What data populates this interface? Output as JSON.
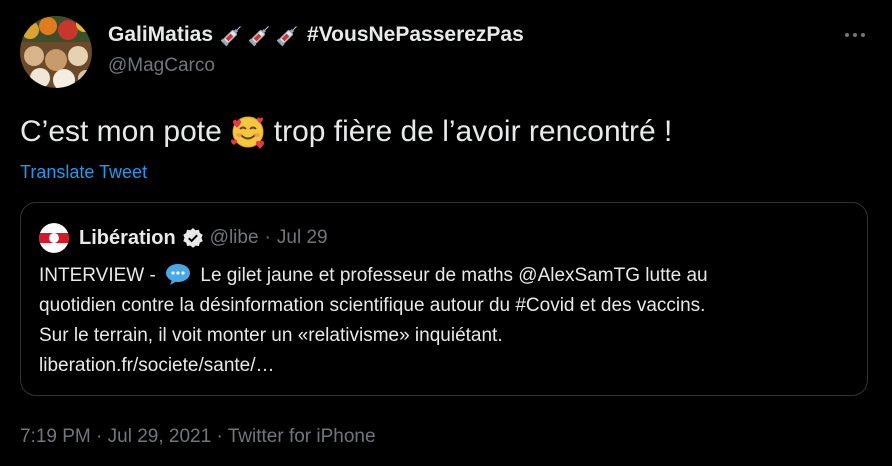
{
  "author": {
    "display_name": "GaliMatias",
    "hashtag": "#VousNePasserezPas",
    "handle": "@MagCarco",
    "name_icons": [
      "syringe-icon",
      "syringe-icon",
      "syringe-icon"
    ]
  },
  "more_icon": "more-options-icon",
  "tweet": {
    "text_before_emoji": "C’est mon pote",
    "emoji": "smiling-face-with-hearts-icon",
    "text_after_emoji": "trop fière de l’avoir rencontré !",
    "translate_label": "Translate Tweet"
  },
  "quoted": {
    "name": "Libération",
    "verified": true,
    "handle": "@libe",
    "separator": "·",
    "date": "Jul 29",
    "prefix": "INTERVIEW -",
    "prefix_icon": "speech-balloon-icon",
    "line1_rest": "Le gilet jaune et professeur de maths @AlexSamTG lutte au",
    "line2": "quotidien contre la désinformation scientifique autour du #Covid et des vaccins.",
    "line3": "Sur le terrain, il voit monter un «relativisme» inquiétant.",
    "line4": "liberation.fr/societe/sante/…"
  },
  "meta": {
    "text": "7:19 PM · Jul 29, 2021 · Twitter for iPhone"
  },
  "colors": {
    "background": "#000000",
    "primary_text": "#e7e9ea",
    "secondary_text": "#71767b",
    "link": "#1d9bf0",
    "border": "#2f3336"
  }
}
